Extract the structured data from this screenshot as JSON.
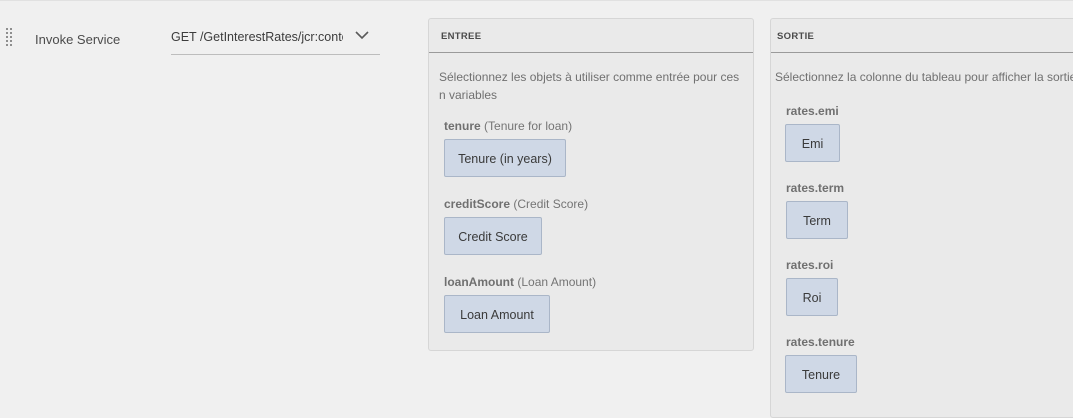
{
  "rule": {
    "action_label": "Invoke Service",
    "service": {
      "selected": "GET /GetInterestRates/jcr:content"
    }
  },
  "input_panel": {
    "header": "ENTREE",
    "description": "Sélectionnez les objets à utiliser comme entrée pour ces n variables",
    "fields": [
      {
        "name": "tenure",
        "hint": "(Tenure for loan)",
        "value": "Tenure (in years)"
      },
      {
        "name": "creditScore",
        "hint": "(Credit Score)",
        "value": "Credit Score"
      },
      {
        "name": "loanAmount",
        "hint": "(Loan Amount)",
        "value": "Loan Amount"
      }
    ]
  },
  "output_panel": {
    "header": "SORTIE",
    "description": "Sélectionnez la colonne du tableau pour afficher la sortie",
    "fields": [
      {
        "name": "rates.emi",
        "value": "Emi"
      },
      {
        "name": "rates.term",
        "value": "Term"
      },
      {
        "name": "rates.roi",
        "value": "Roi"
      },
      {
        "name": "rates.tenure",
        "value": "Tenure"
      }
    ]
  },
  "icons": {
    "drag": "drag-handle-icon",
    "dropdown": "chevron-down-icon"
  },
  "colors": {
    "background": "#f0f0f0",
    "panel": "#eaeaea",
    "chip": "#cfd8e6",
    "chip_border": "#aab6c8"
  }
}
